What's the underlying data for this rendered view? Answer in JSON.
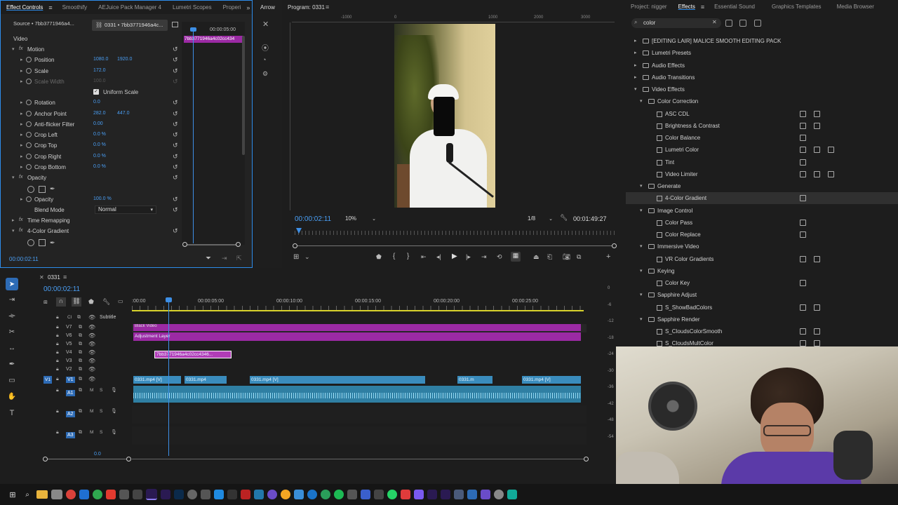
{
  "effect_controls": {
    "tabs": [
      "Effect Controls",
      "Smoothify",
      "AEJuice Pack Manager 4",
      "Lumetri Scopes",
      "Properi"
    ],
    "source_label": "Source • 7bb3771946a4...",
    "sequence_label": "0331 • 7bb3771946a4c...",
    "mini_time": "00:00:05:00",
    "mini_clip": "7bb3771946a4c02cc434",
    "video_header": "Video",
    "rows": [
      {
        "name": "Motion",
        "v1": "",
        "v2": "",
        "level": 0,
        "group": true
      },
      {
        "name": "Position",
        "v1": "1080.0",
        "v2": "1920.0",
        "level": 1
      },
      {
        "name": "Scale",
        "v1": "172.0",
        "v2": "",
        "level": 1
      },
      {
        "name": "Scale Width",
        "v1": "100.0",
        "v2": "",
        "level": 1,
        "dim": true
      },
      {
        "name": "Uniform Scale",
        "v1": "",
        "v2": "",
        "level": 2,
        "check": true
      },
      {
        "name": "Rotation",
        "v1": "0.0",
        "v2": "",
        "level": 1
      },
      {
        "name": "Anchor Point",
        "v1": "282.0",
        "v2": "447.0",
        "level": 1
      },
      {
        "name": "Anti-flicker Filter",
        "v1": "0.00",
        "v2": "",
        "level": 1
      },
      {
        "name": "Crop Left",
        "v1": "0.0 %",
        "v2": "",
        "level": 1
      },
      {
        "name": "Crop Top",
        "v1": "0.0 %",
        "v2": "",
        "level": 1
      },
      {
        "name": "Crop Right",
        "v1": "0.0 %",
        "v2": "",
        "level": 1
      },
      {
        "name": "Crop Bottom",
        "v1": "0.0 %",
        "v2": "",
        "level": 1
      },
      {
        "name": "Opacity",
        "v1": "",
        "v2": "",
        "level": 0,
        "group": true
      },
      {
        "name": "",
        "v1": "",
        "v2": "",
        "level": 1,
        "shapes": true
      },
      {
        "name": "Opacity",
        "v1": "100.0 %",
        "v2": "",
        "level": 1
      },
      {
        "name": "Blend Mode",
        "v1": "Normal",
        "v2": "",
        "level": 1,
        "select": true
      },
      {
        "name": "Time Remapping",
        "v1": "",
        "v2": "",
        "level": 0
      },
      {
        "name": "4-Color Gradient",
        "v1": "",
        "v2": "",
        "level": 0,
        "group": true
      },
      {
        "name": "",
        "v1": "",
        "v2": "",
        "level": 1,
        "shapes": true
      }
    ],
    "footer_time": "00:00:02:11"
  },
  "tools_panel": {
    "label": "Arrow"
  },
  "program": {
    "title": "Program: 0331",
    "ruler": [
      "-1000",
      "0",
      "1000",
      "2000",
      "3000"
    ],
    "timecode": "00:00:02:11",
    "zoom": "10%",
    "quality": "1/8",
    "duration": "00:01:49:27"
  },
  "timeline": {
    "sequence_name": "0331",
    "timecode": "00:00:02:11",
    "ruler": [
      ":00:00",
      "00:00:05:00",
      "00:00:10:00",
      "00:00:15:00",
      "00:00:20:00",
      "00:00:25:00"
    ],
    "tracks": [
      "V7",
      "V6",
      "V5",
      "V4",
      "V3",
      "V2",
      "V1",
      "A1",
      "A2",
      "A3"
    ],
    "subtitle_label": "Subtitle",
    "clips": {
      "black_video": "Black Video",
      "adjustment": "Adjustment Layer",
      "v4_clip": "7bb3771946a4c02cc4346...",
      "v1_a": "0331.mp4 [V]",
      "v1_b": "0331.mp4",
      "v1_c": "0331.mp4 [V]",
      "v1_d": "0331.m",
      "v1_e": "0331.mp4 [V]"
    },
    "db_scale": [
      "0",
      "-6",
      "-12",
      "-18",
      "-24",
      "-30",
      "-36",
      "-42",
      "-48",
      "-54"
    ],
    "bottom_value": "0.0"
  },
  "effects_panel": {
    "tabs": [
      "Project: nigger",
      "Effects",
      "Essential Sound",
      "Graphics Templates",
      "Media Browser"
    ],
    "search_value": "color",
    "tree": [
      {
        "label": "[EDITING LAIR] MALICE SMOOTH EDITING PACK",
        "level": 0,
        "type": "folder",
        "open": false,
        "badges": 0
      },
      {
        "label": "Lumetri Presets",
        "level": 0,
        "type": "folder",
        "open": false,
        "badges": 0
      },
      {
        "label": "Audio Effects",
        "level": 0,
        "type": "folder",
        "open": false,
        "badges": 0
      },
      {
        "label": "Audio Transitions",
        "level": 0,
        "type": "folder",
        "open": false,
        "badges": 0
      },
      {
        "label": "Video Effects",
        "level": 0,
        "type": "folder",
        "open": true,
        "badges": 0
      },
      {
        "label": "Color Correction",
        "level": 1,
        "type": "folder",
        "open": true,
        "badges": 0
      },
      {
        "label": "ASC CDL",
        "level": 2,
        "type": "fx",
        "badges": 2
      },
      {
        "label": "Brightness & Contrast",
        "level": 2,
        "type": "fx",
        "badges": 2
      },
      {
        "label": "Color Balance",
        "level": 2,
        "type": "fx",
        "badges": 1
      },
      {
        "label": "Lumetri Color",
        "level": 2,
        "type": "fx",
        "badges": 3
      },
      {
        "label": "Tint",
        "level": 2,
        "type": "fx",
        "badges": 1
      },
      {
        "label": "Video Limiter",
        "level": 2,
        "type": "fx",
        "badges": 3
      },
      {
        "label": "Generate",
        "level": 1,
        "type": "folder",
        "open": true,
        "badges": 0
      },
      {
        "label": "4-Color Gradient",
        "level": 2,
        "type": "fx",
        "badges": 1,
        "selected": true
      },
      {
        "label": "Image Control",
        "level": 1,
        "type": "folder",
        "open": true,
        "badges": 0
      },
      {
        "label": "Color Pass",
        "level": 2,
        "type": "fx",
        "badges": 1
      },
      {
        "label": "Color Replace",
        "level": 2,
        "type": "fx",
        "badges": 1
      },
      {
        "label": "Immersive Video",
        "level": 1,
        "type": "folder",
        "open": true,
        "badges": 0
      },
      {
        "label": "VR Color Gradients",
        "level": 2,
        "type": "fx",
        "badges": 2
      },
      {
        "label": "Keying",
        "level": 1,
        "type": "folder",
        "open": true,
        "badges": 0
      },
      {
        "label": "Color Key",
        "level": 2,
        "type": "fx",
        "badges": 1
      },
      {
        "label": "Sapphire Adjust",
        "level": 1,
        "type": "folder",
        "open": true,
        "badges": 0
      },
      {
        "label": "S_ShowBadColors",
        "level": 2,
        "type": "fx",
        "badges": 2
      },
      {
        "label": "Sapphire Render",
        "level": 1,
        "type": "folder",
        "open": true,
        "badges": 0
      },
      {
        "label": "S_CloudsColorSmooth",
        "level": 2,
        "type": "fx",
        "badges": 2
      },
      {
        "label": "S_CloudsMultColor",
        "level": 2,
        "type": "fx",
        "badges": 2
      }
    ]
  },
  "colors": {
    "accent": "#2d8ceb",
    "adjustment": "#9b2aa4",
    "v1_clip": "#3a8cbd",
    "audio": "#2f7fa3"
  }
}
